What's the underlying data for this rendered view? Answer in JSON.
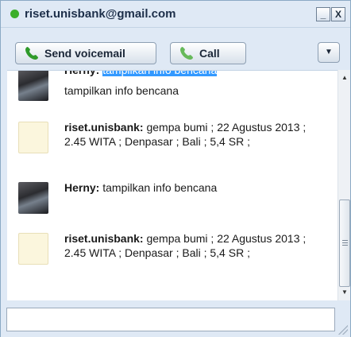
{
  "window": {
    "title": "riset.unisbank@gmail.com",
    "status_color": "#3cae2a",
    "minimize_label": "_",
    "close_label": "X"
  },
  "toolbar": {
    "voicemail_label": "Send voicemail",
    "call_label": "Call",
    "menu_icon": "▼"
  },
  "messages": [
    {
      "sender": "Herny:",
      "highlighted": "tampilkan info bencana",
      "text": "tampilkan info bencana",
      "avatar": "photo"
    },
    {
      "sender": "riset.unisbank:",
      "text": " gempa bumi ; 22 Agustus 2013 ; 2.45 WITA ; Denpasar ; Bali ; 5,4 SR ;",
      "avatar": "placeholder"
    },
    {
      "sender": "Herny:",
      "text": " tampilkan info bencana",
      "avatar": "photo"
    },
    {
      "sender": "riset.unisbank:",
      "text": " gempa bumi ; 22 Agustus 2013 ; 2.45 WITA ; Denpasar ; Bali ; 5,4 SR ;",
      "avatar": "placeholder"
    }
  ],
  "input": {
    "value": "",
    "placeholder": ""
  },
  "colors": {
    "accent": "#3399ff",
    "frame": "#dfe9f5"
  }
}
